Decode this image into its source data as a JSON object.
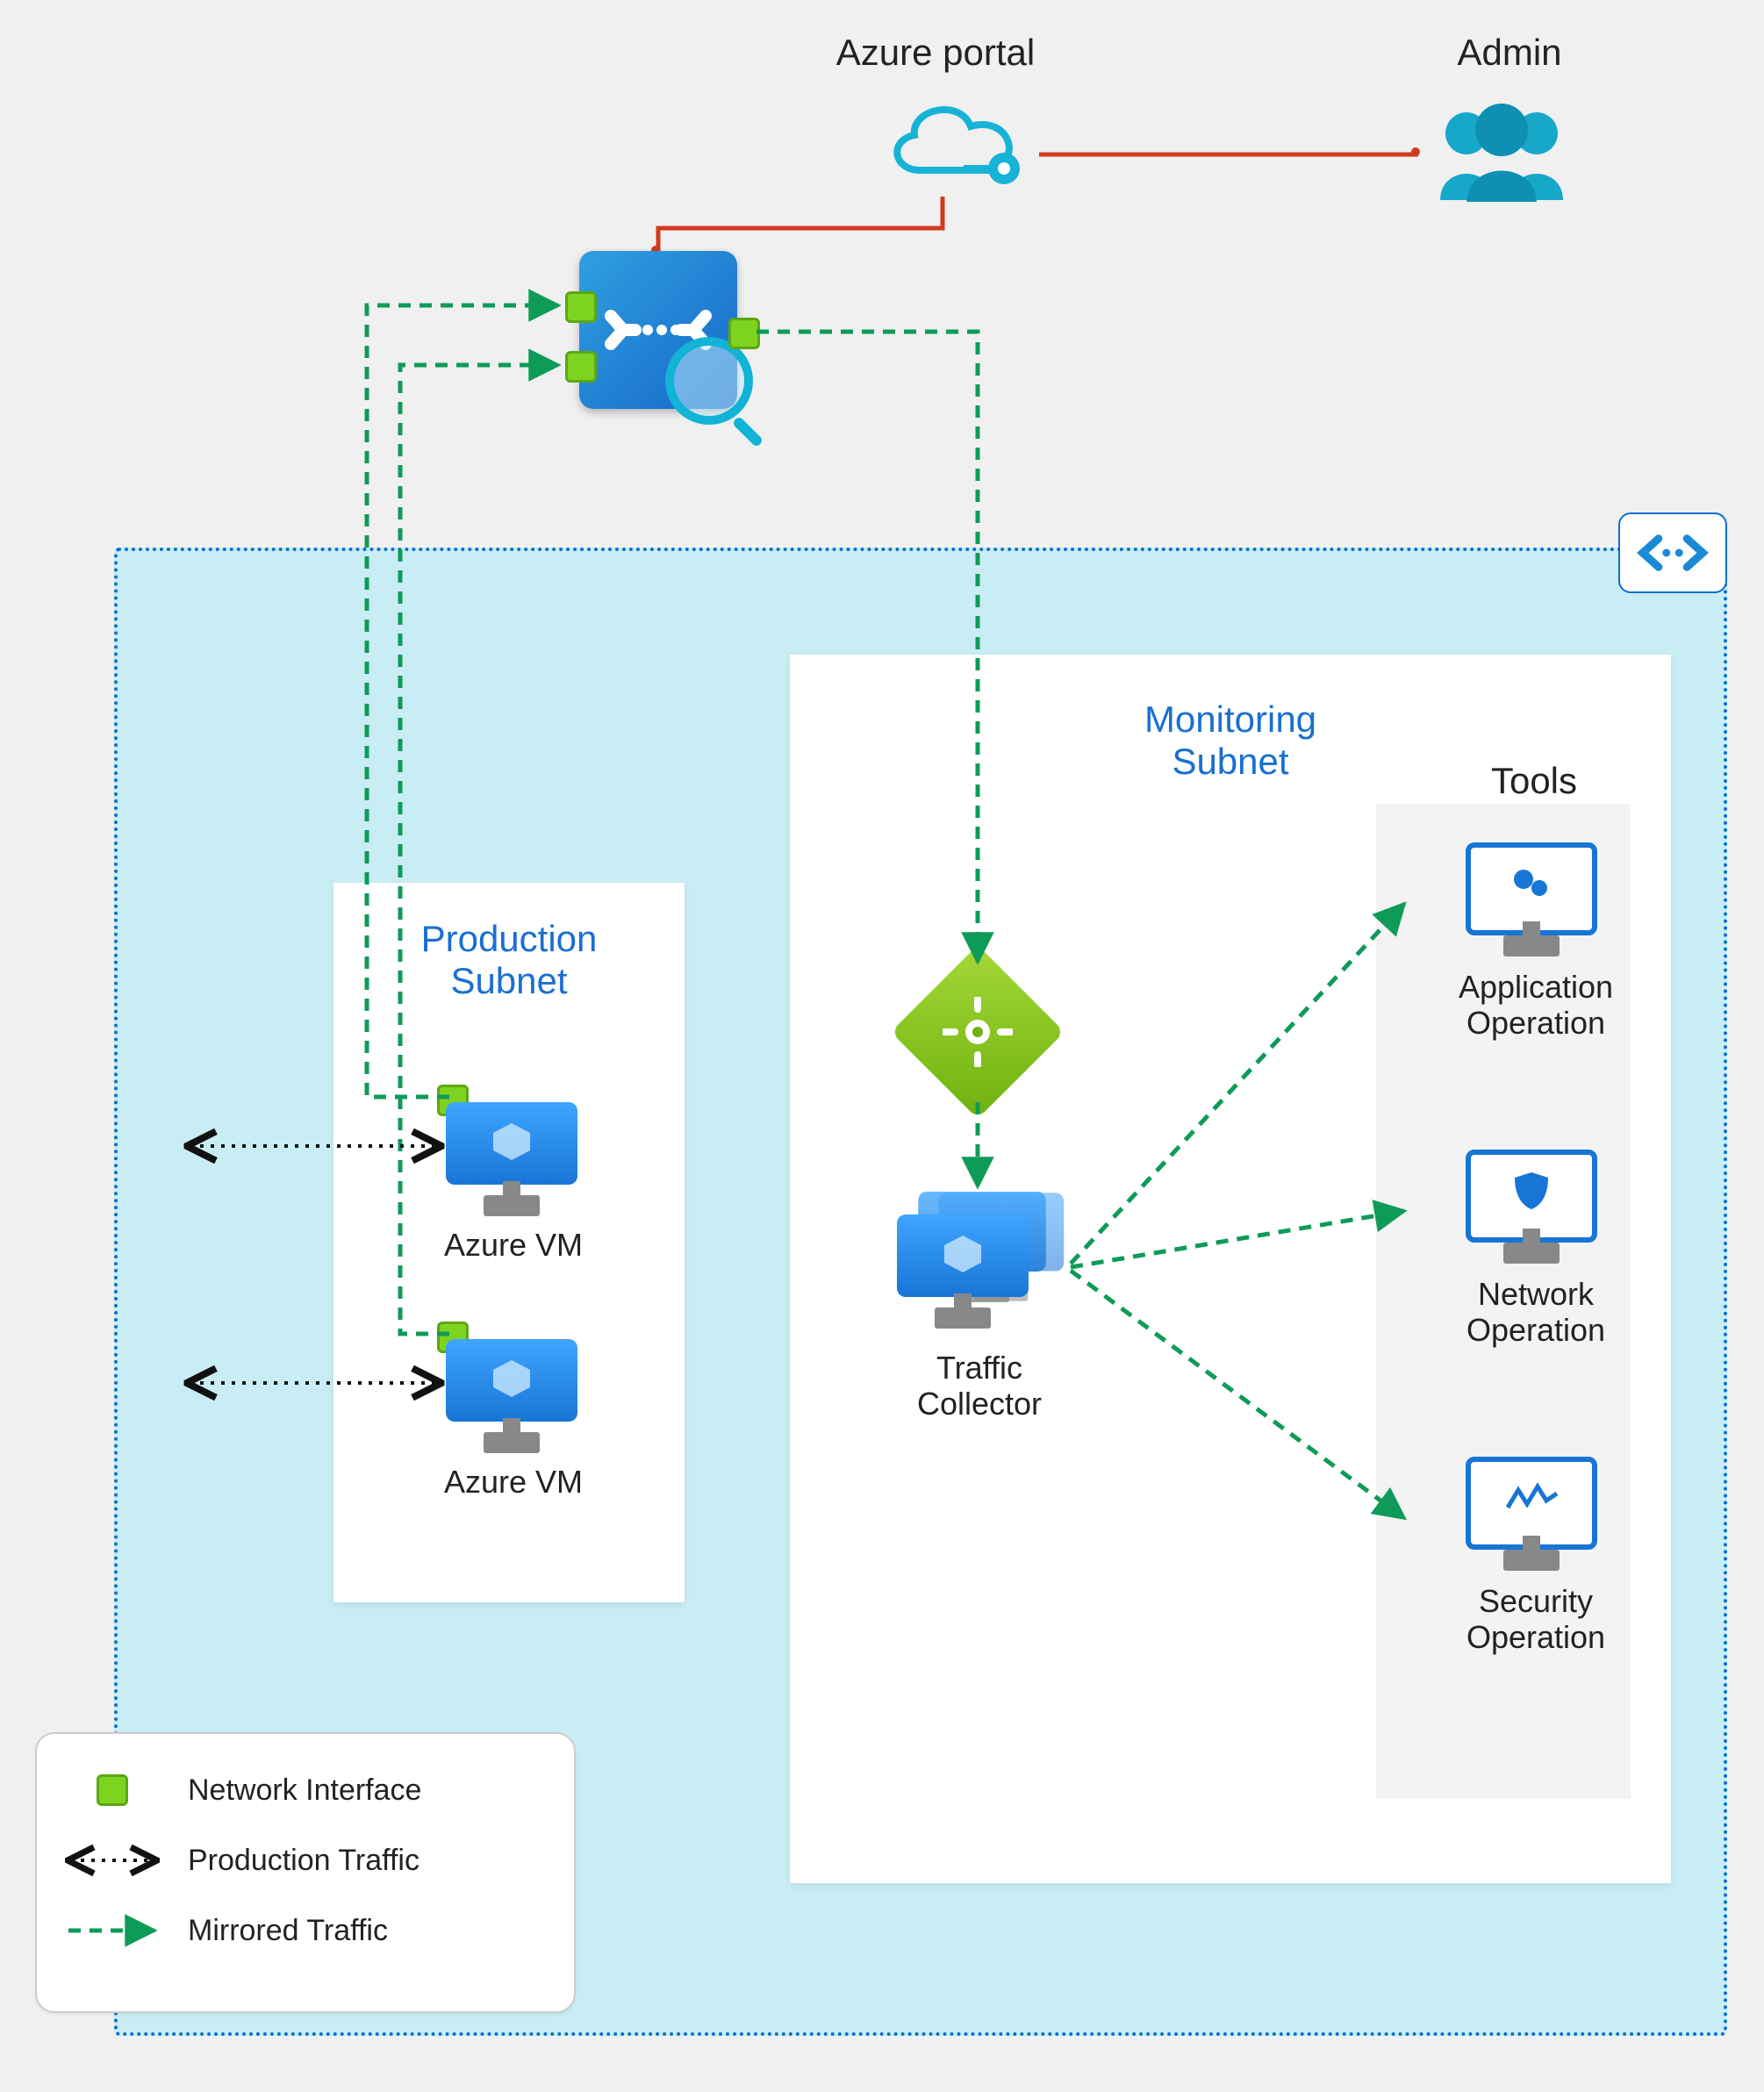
{
  "header": {
    "portal_label": "Azure portal",
    "admin_label": "Admin"
  },
  "vnet": {
    "production_subnet_title": "Production\nSubnet",
    "monitoring_subnet_title": "Monitoring\nSubnet",
    "vm_label_1": "Azure VM",
    "vm_label_2": "Azure VM",
    "traffic_collector_label": "Traffic\nCollector",
    "tools_title": "Tools",
    "tool_app_label": "Application\nOperation",
    "tool_net_label": "Network\nOperation",
    "tool_sec_label": "Security\nOperation"
  },
  "legend": {
    "nic": "Network Interface",
    "prod_traffic": "Production Traffic",
    "mirrored_traffic": "Mirrored Traffic"
  },
  "icons": {
    "vnet_badge": "vnet-angle-icon",
    "tap": "network-tap-icon",
    "magnifier": "magnifier-icon",
    "cloud": "azure-cloud-icon",
    "admin_group": "admin-users-icon",
    "vm": "azure-vm-icon",
    "load_balancer": "load-balancer-icon",
    "tool_app": "application-gears-icon",
    "tool_net": "shield-icon",
    "tool_sec": "waveform-icon",
    "nic": "nic-square-icon"
  },
  "colors": {
    "azure_blue": "#1775d6",
    "mirror_green": "#0e9b57",
    "prod_black": "#111111",
    "admin_red": "#d33a1f",
    "nic_green": "#7ed321",
    "vnet_bg": "#c9edf4"
  }
}
